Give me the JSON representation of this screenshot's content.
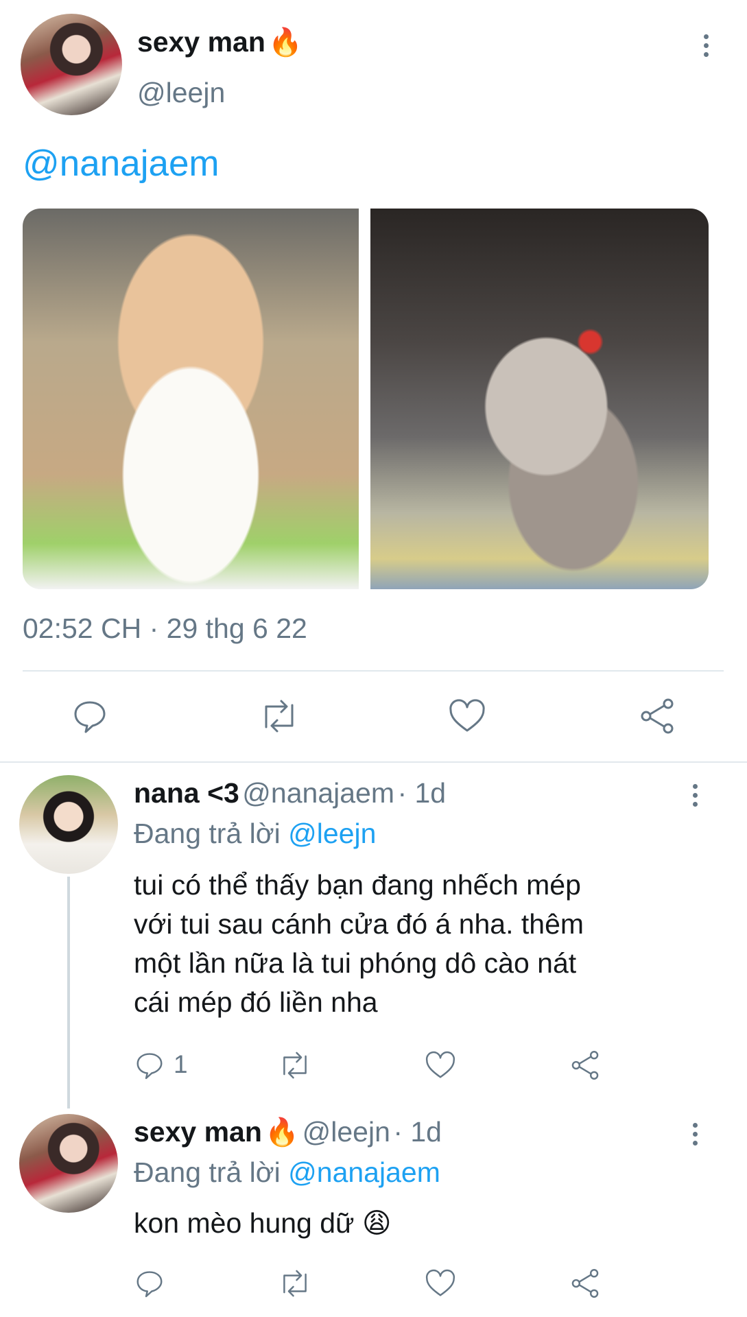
{
  "tweet": {
    "display_name": "sexy man",
    "name_emoji": "🔥",
    "handle": "@leejn",
    "text_mention": "@nanajaem",
    "timestamp": "02:52 CH · 29 thg 6 22"
  },
  "replies": [
    {
      "display_name": "nana <3",
      "handle": "@nanajaem",
      "age": "· 1d",
      "replying_prefix": "Đang trả lời",
      "replying_to": "@leejn",
      "lines": [
        "tui có thể thấy bạn đang nhếch mép",
        "với tui sau cánh cửa đó á nha. thêm",
        "một lần nữa là tui phóng dô cào nát",
        "cái mép đó liền nha"
      ],
      "reply_count": "1"
    },
    {
      "display_name": "sexy man",
      "name_emoji": "🔥",
      "handle": "@leejn",
      "age": "· 1d",
      "replying_prefix": "Đang trả lời",
      "replying_to": "@nanajaem",
      "text": "kon mèo hung dữ",
      "text_emoji": "😩"
    }
  ],
  "icons": {
    "reply": "reply-icon",
    "retweet": "retweet-icon",
    "like": "like-icon",
    "share": "share-icon",
    "more": "more-vertical-icon"
  },
  "colors": {
    "link": "#1da1f2",
    "secondary_text": "#657786",
    "divider": "#e1e8ed"
  }
}
